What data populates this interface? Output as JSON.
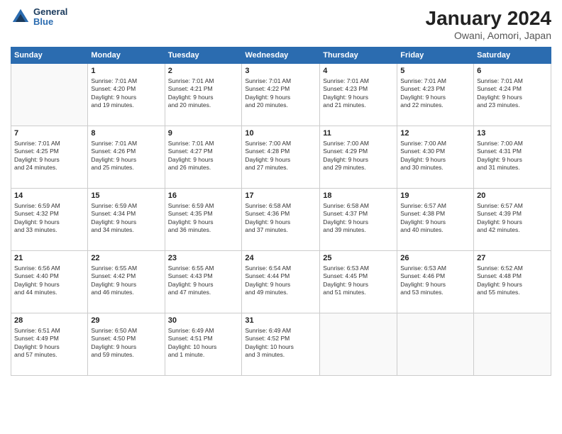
{
  "header": {
    "logo": {
      "general": "General",
      "blue": "Blue"
    },
    "title": "January 2024",
    "subtitle": "Owani, Aomori, Japan"
  },
  "weekdays": [
    "Sunday",
    "Monday",
    "Tuesday",
    "Wednesday",
    "Thursday",
    "Friday",
    "Saturday"
  ],
  "weeks": [
    [
      {
        "day": "",
        "info": ""
      },
      {
        "day": "1",
        "info": "Sunrise: 7:01 AM\nSunset: 4:20 PM\nDaylight: 9 hours\nand 19 minutes."
      },
      {
        "day": "2",
        "info": "Sunrise: 7:01 AM\nSunset: 4:21 PM\nDaylight: 9 hours\nand 20 minutes."
      },
      {
        "day": "3",
        "info": "Sunrise: 7:01 AM\nSunset: 4:22 PM\nDaylight: 9 hours\nand 20 minutes."
      },
      {
        "day": "4",
        "info": "Sunrise: 7:01 AM\nSunset: 4:23 PM\nDaylight: 9 hours\nand 21 minutes."
      },
      {
        "day": "5",
        "info": "Sunrise: 7:01 AM\nSunset: 4:23 PM\nDaylight: 9 hours\nand 22 minutes."
      },
      {
        "day": "6",
        "info": "Sunrise: 7:01 AM\nSunset: 4:24 PM\nDaylight: 9 hours\nand 23 minutes."
      }
    ],
    [
      {
        "day": "7",
        "info": "Sunrise: 7:01 AM\nSunset: 4:25 PM\nDaylight: 9 hours\nand 24 minutes."
      },
      {
        "day": "8",
        "info": "Sunrise: 7:01 AM\nSunset: 4:26 PM\nDaylight: 9 hours\nand 25 minutes."
      },
      {
        "day": "9",
        "info": "Sunrise: 7:01 AM\nSunset: 4:27 PM\nDaylight: 9 hours\nand 26 minutes."
      },
      {
        "day": "10",
        "info": "Sunrise: 7:00 AM\nSunset: 4:28 PM\nDaylight: 9 hours\nand 27 minutes."
      },
      {
        "day": "11",
        "info": "Sunrise: 7:00 AM\nSunset: 4:29 PM\nDaylight: 9 hours\nand 29 minutes."
      },
      {
        "day": "12",
        "info": "Sunrise: 7:00 AM\nSunset: 4:30 PM\nDaylight: 9 hours\nand 30 minutes."
      },
      {
        "day": "13",
        "info": "Sunrise: 7:00 AM\nSunset: 4:31 PM\nDaylight: 9 hours\nand 31 minutes."
      }
    ],
    [
      {
        "day": "14",
        "info": "Sunrise: 6:59 AM\nSunset: 4:32 PM\nDaylight: 9 hours\nand 33 minutes."
      },
      {
        "day": "15",
        "info": "Sunrise: 6:59 AM\nSunset: 4:34 PM\nDaylight: 9 hours\nand 34 minutes."
      },
      {
        "day": "16",
        "info": "Sunrise: 6:59 AM\nSunset: 4:35 PM\nDaylight: 9 hours\nand 36 minutes."
      },
      {
        "day": "17",
        "info": "Sunrise: 6:58 AM\nSunset: 4:36 PM\nDaylight: 9 hours\nand 37 minutes."
      },
      {
        "day": "18",
        "info": "Sunrise: 6:58 AM\nSunset: 4:37 PM\nDaylight: 9 hours\nand 39 minutes."
      },
      {
        "day": "19",
        "info": "Sunrise: 6:57 AM\nSunset: 4:38 PM\nDaylight: 9 hours\nand 40 minutes."
      },
      {
        "day": "20",
        "info": "Sunrise: 6:57 AM\nSunset: 4:39 PM\nDaylight: 9 hours\nand 42 minutes."
      }
    ],
    [
      {
        "day": "21",
        "info": "Sunrise: 6:56 AM\nSunset: 4:40 PM\nDaylight: 9 hours\nand 44 minutes."
      },
      {
        "day": "22",
        "info": "Sunrise: 6:55 AM\nSunset: 4:42 PM\nDaylight: 9 hours\nand 46 minutes."
      },
      {
        "day": "23",
        "info": "Sunrise: 6:55 AM\nSunset: 4:43 PM\nDaylight: 9 hours\nand 47 minutes."
      },
      {
        "day": "24",
        "info": "Sunrise: 6:54 AM\nSunset: 4:44 PM\nDaylight: 9 hours\nand 49 minutes."
      },
      {
        "day": "25",
        "info": "Sunrise: 6:53 AM\nSunset: 4:45 PM\nDaylight: 9 hours\nand 51 minutes."
      },
      {
        "day": "26",
        "info": "Sunrise: 6:53 AM\nSunset: 4:46 PM\nDaylight: 9 hours\nand 53 minutes."
      },
      {
        "day": "27",
        "info": "Sunrise: 6:52 AM\nSunset: 4:48 PM\nDaylight: 9 hours\nand 55 minutes."
      }
    ],
    [
      {
        "day": "28",
        "info": "Sunrise: 6:51 AM\nSunset: 4:49 PM\nDaylight: 9 hours\nand 57 minutes."
      },
      {
        "day": "29",
        "info": "Sunrise: 6:50 AM\nSunset: 4:50 PM\nDaylight: 9 hours\nand 59 minutes."
      },
      {
        "day": "30",
        "info": "Sunrise: 6:49 AM\nSunset: 4:51 PM\nDaylight: 10 hours\nand 1 minute."
      },
      {
        "day": "31",
        "info": "Sunrise: 6:49 AM\nSunset: 4:52 PM\nDaylight: 10 hours\nand 3 minutes."
      },
      {
        "day": "",
        "info": ""
      },
      {
        "day": "",
        "info": ""
      },
      {
        "day": "",
        "info": ""
      }
    ]
  ]
}
